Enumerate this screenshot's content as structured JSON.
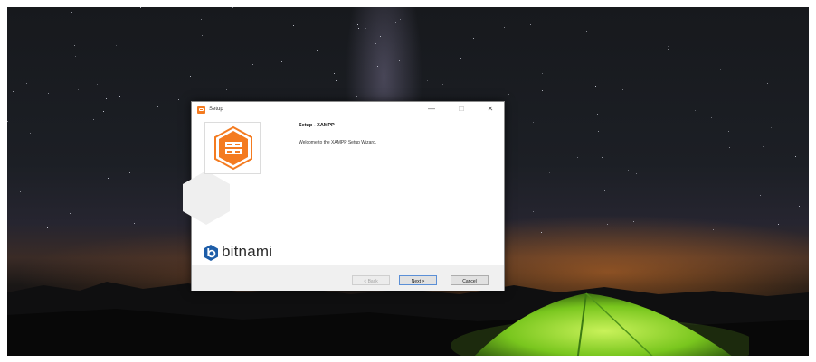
{
  "window": {
    "title": "Setup",
    "controls": {
      "minimize": "—",
      "maximize": "☐",
      "close": "✕"
    }
  },
  "sidebar": {
    "brand_label": "bitnami",
    "app_logo_icon": "xampp-logo-icon",
    "brand_icon": "bitnami-icon"
  },
  "content": {
    "heading": "Setup - XAMPP",
    "welcome": "Welcome to the XAMPP Setup Wizard."
  },
  "buttons": {
    "back": "< Back",
    "next": "Next >",
    "cancel": "Cancel"
  },
  "colors": {
    "xampp_orange": "#f47b20",
    "tent_green": "#8bd62a",
    "bitnami_blue": "#1d5da8"
  }
}
